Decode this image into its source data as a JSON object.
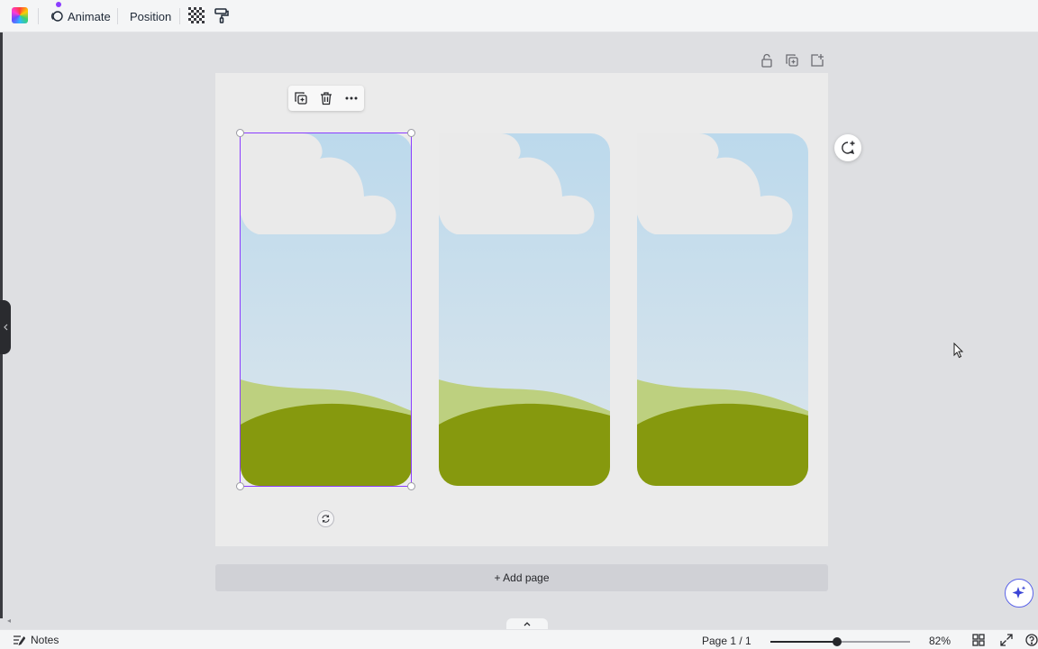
{
  "toolbar": {
    "color_icon": "color-palette-icon",
    "animate_label": "Animate",
    "position_label": "Position",
    "transparency_icon": "transparency-icon",
    "format_painter_icon": "paint-roller-icon"
  },
  "page_actions": {
    "lock_icon": "lock-icon",
    "duplicate_icon": "duplicate-page-icon",
    "add_icon": "add-page-icon"
  },
  "element_toolbar": {
    "duplicate_icon": "duplicate-icon",
    "delete_icon": "trash-icon",
    "more_icon": "more-icon"
  },
  "canvas": {
    "frames": [
      {
        "name": "frame-1",
        "selected": true
      },
      {
        "name": "frame-2",
        "selected": false
      },
      {
        "name": "frame-3",
        "selected": false
      }
    ],
    "colors": {
      "sky_top": "#bcd9ec",
      "sky_bottom": "#dce6ec",
      "cloud": "#eaeaea",
      "hill_light": "#bdd07f",
      "hill_dark": "#86990e",
      "page": "#ebebeb",
      "selection": "#8b3dff"
    }
  },
  "add_page": {
    "label": "+ Add page"
  },
  "footer": {
    "notes_label": "Notes",
    "page_indicator": "Page 1 / 1",
    "zoom_percent": 82,
    "zoom_label": "82%"
  }
}
